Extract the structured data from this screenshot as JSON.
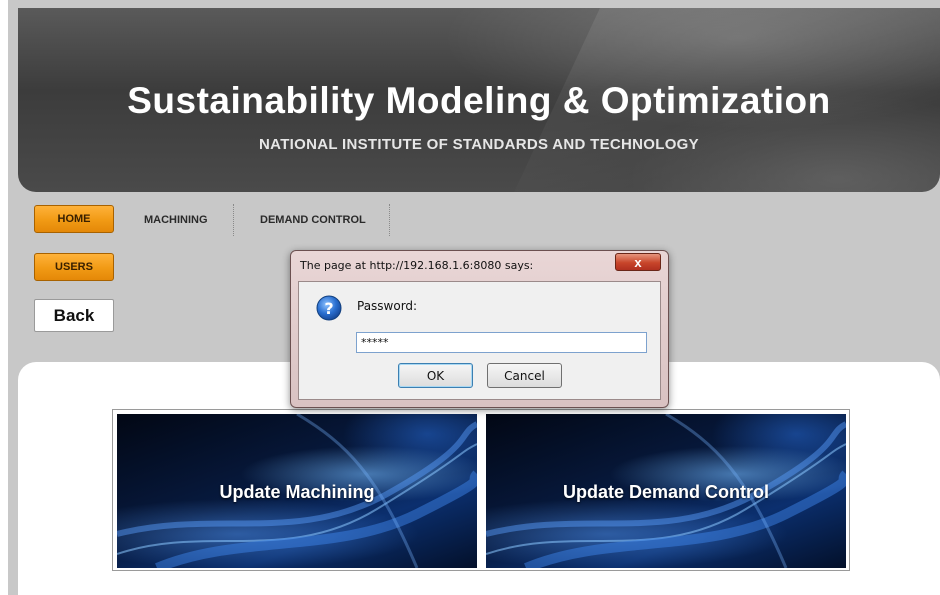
{
  "banner": {
    "title": "Sustainability Modeling & Optimization",
    "subtitle": "NATIONAL INSTITUTE OF STANDARDS AND TECHNOLOGY"
  },
  "nav": {
    "home_label": "HOME",
    "users_label": "USERS",
    "menu_items": [
      "MACHINING",
      "DEMAND CONTROL"
    ],
    "back_label": "Back"
  },
  "tiles": [
    {
      "label": "Update Machining"
    },
    {
      "label": "Update Demand Control"
    }
  ],
  "dialog": {
    "title": "The page at http://192.168.1.6:8080 says:",
    "close_glyph": "x",
    "message": "Password:",
    "input_value": "*****",
    "ok_label": "OK",
    "cancel_label": "Cancel",
    "icon": "question-icon"
  },
  "colors": {
    "nav_button": "#f19a14",
    "banner": "#3c3c3c",
    "tile": "#0b2f6e"
  }
}
